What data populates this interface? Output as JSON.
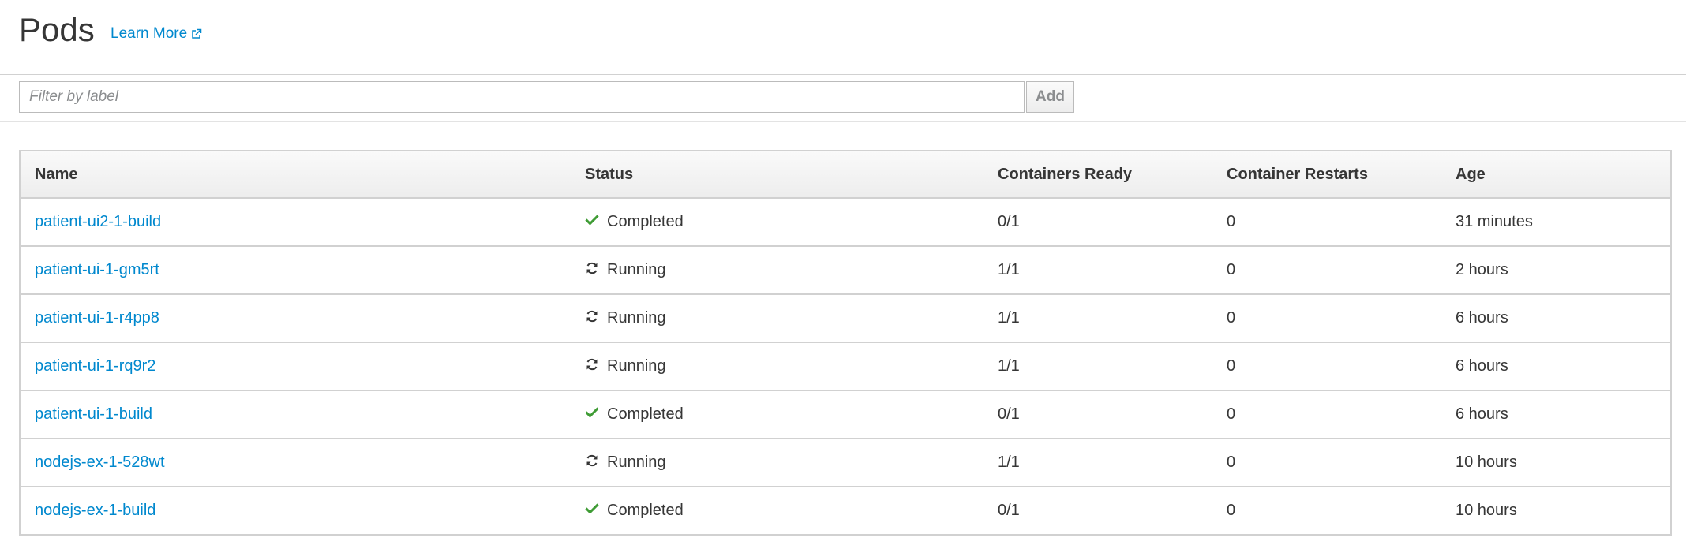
{
  "header": {
    "title": "Pods",
    "learn_more": "Learn More"
  },
  "filter": {
    "placeholder": "Filter by label",
    "add_label": "Add"
  },
  "table": {
    "columns": [
      "Name",
      "Status",
      "Containers Ready",
      "Container Restarts",
      "Age"
    ],
    "rows": [
      {
        "name": "patient-ui2-1-build",
        "status": "Completed",
        "status_icon": "check-icon",
        "ready": "0/1",
        "restarts": "0",
        "age": "31 minutes"
      },
      {
        "name": "patient-ui-1-gm5rt",
        "status": "Running",
        "status_icon": "refresh-icon",
        "ready": "1/1",
        "restarts": "0",
        "age": "2 hours"
      },
      {
        "name": "patient-ui-1-r4pp8",
        "status": "Running",
        "status_icon": "refresh-icon",
        "ready": "1/1",
        "restarts": "0",
        "age": "6 hours"
      },
      {
        "name": "patient-ui-1-rq9r2",
        "status": "Running",
        "status_icon": "refresh-icon",
        "ready": "1/1",
        "restarts": "0",
        "age": "6 hours"
      },
      {
        "name": "patient-ui-1-build",
        "status": "Completed",
        "status_icon": "check-icon",
        "ready": "0/1",
        "restarts": "0",
        "age": "6 hours"
      },
      {
        "name": "nodejs-ex-1-528wt",
        "status": "Running",
        "status_icon": "refresh-icon",
        "ready": "1/1",
        "restarts": "0",
        "age": "10 hours"
      },
      {
        "name": "nodejs-ex-1-build",
        "status": "Completed",
        "status_icon": "check-icon",
        "ready": "0/1",
        "restarts": "0",
        "age": "10 hours"
      }
    ]
  },
  "colors": {
    "link": "#0088ce",
    "success": "#3f9c35",
    "text": "#363636",
    "border": "#d1d1d1"
  }
}
